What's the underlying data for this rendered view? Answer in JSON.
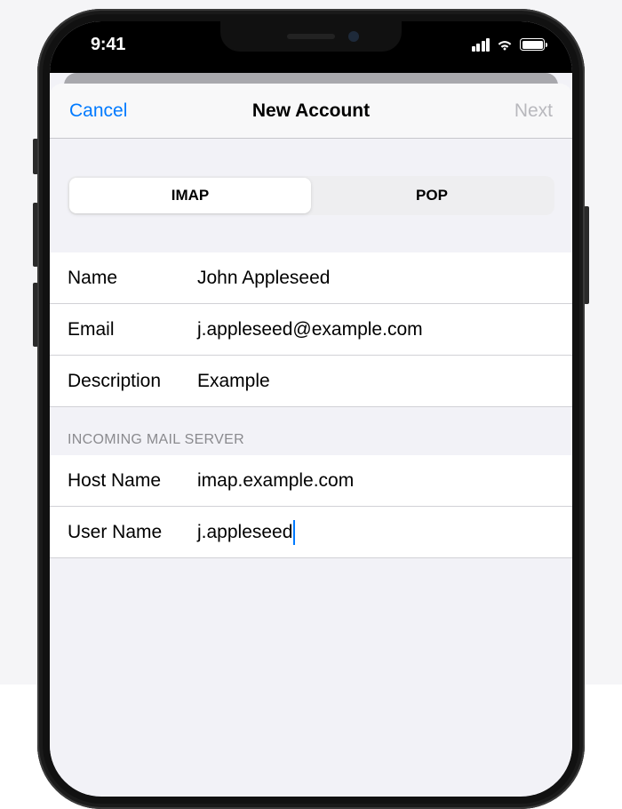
{
  "statusBar": {
    "time": "9:41"
  },
  "nav": {
    "cancel": "Cancel",
    "title": "New Account",
    "next": "Next"
  },
  "tabs": {
    "imap": "IMAP",
    "pop": "POP",
    "selected": "IMAP"
  },
  "account": {
    "nameLabel": "Name",
    "nameValue": "John Appleseed",
    "emailLabel": "Email",
    "emailValue": "j.appleseed@example.com",
    "descLabel": "Description",
    "descValue": "Example"
  },
  "incoming": {
    "header": "INCOMING MAIL SERVER",
    "hostLabel": "Host Name",
    "hostValue": "imap.example.com",
    "userLabel": "User Name",
    "userValue": "j.appleseed"
  }
}
